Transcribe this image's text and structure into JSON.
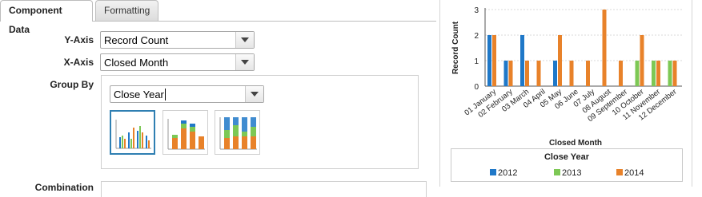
{
  "tabs": [
    {
      "label": "Component Data",
      "active": true
    },
    {
      "label": "Formatting",
      "active": false
    }
  ],
  "form": {
    "y_axis": {
      "label": "Y-Axis",
      "value": "Record Count"
    },
    "x_axis": {
      "label": "X-Axis",
      "value": "Closed Month"
    },
    "group_by": {
      "label": "Group By",
      "value": "Close Year"
    },
    "next_label_partial": "Combination"
  },
  "chart_type_thumbnails": [
    {
      "icon": "grouped-bar-chart-icon",
      "selected": true
    },
    {
      "icon": "stacked-bar-chart-icon",
      "selected": false
    },
    {
      "icon": "stacked-100-bar-chart-icon",
      "selected": false
    }
  ],
  "colors": {
    "2012": "#1f78c8",
    "2013": "#7dc855",
    "2014": "#e8822a",
    "selected_border": "#2f7fb2"
  },
  "chart_data": {
    "type": "bar",
    "ylabel": "Record Count",
    "xlabel": "Closed Month",
    "ylim": [
      0,
      3
    ],
    "yticks": [
      "0",
      "1",
      "2",
      "3"
    ],
    "grid": true,
    "legend_title": "Close Year",
    "legend_position": "bottom",
    "categories": [
      "01 January",
      "02 February",
      "03 March",
      "04 April",
      "05 May",
      "06 June",
      "07 July",
      "08 August",
      "09 September",
      "10 October",
      "11 November",
      "12 December"
    ],
    "series": [
      {
        "name": "2012",
        "values": [
          2,
          1,
          2,
          0,
          1,
          0,
          0,
          0,
          0,
          0,
          0,
          0
        ]
      },
      {
        "name": "2013",
        "values": [
          0,
          0,
          0,
          0,
          0,
          0,
          0,
          0,
          0,
          1,
          1,
          1
        ]
      },
      {
        "name": "2014",
        "values": [
          2,
          1,
          1,
          1,
          2,
          1,
          1,
          3,
          1,
          2,
          1,
          1
        ]
      }
    ]
  }
}
